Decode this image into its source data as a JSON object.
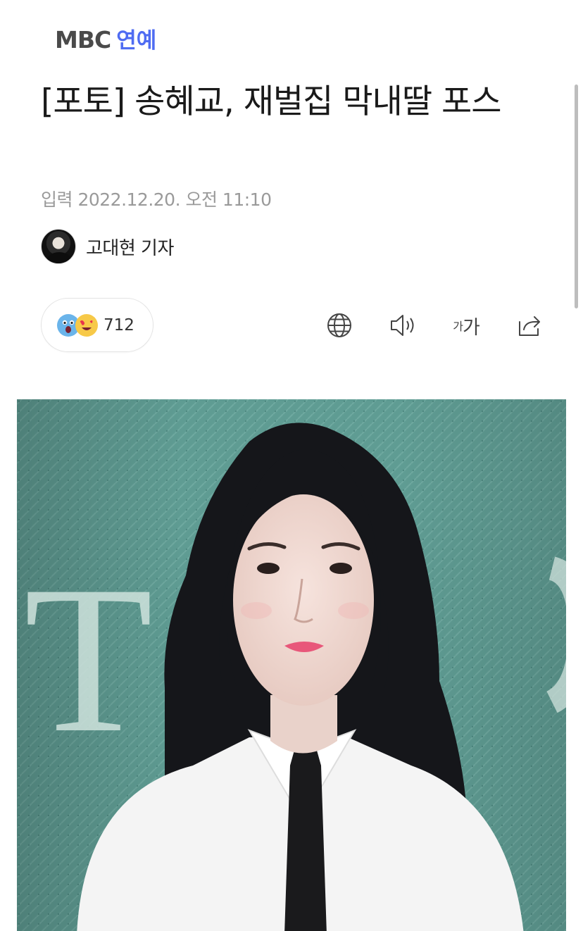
{
  "header": {
    "logo_brand": "MBC",
    "logo_section": "연예"
  },
  "article": {
    "title": "[포토] 송혜교, 재벌집 막내딸 포스",
    "published": "입력 2022.12.20. 오전 11:10",
    "author": "고대현 기자"
  },
  "reactions": {
    "icons": [
      "surprised-emoji",
      "heart-eyes-emoji"
    ],
    "count": "712"
  },
  "toolbar": {
    "translate_icon": "globe-icon",
    "tts_icon": "speaker-icon",
    "font_size_label_small": "가",
    "font_size_label_large": "가",
    "share_icon": "share-icon"
  },
  "photo": {
    "backdrop_letters": "T",
    "colors": {
      "backdrop": "#5f9c93",
      "hair": "#15161a",
      "shirt": "#f4f4f4",
      "tie": "#1a1a1c",
      "lips": "#e8577a"
    }
  },
  "colors": {
    "brand_accent": "#4f6cf2",
    "logo_gray": "#4a4a4a",
    "meta_gray": "#9a9a9a"
  }
}
